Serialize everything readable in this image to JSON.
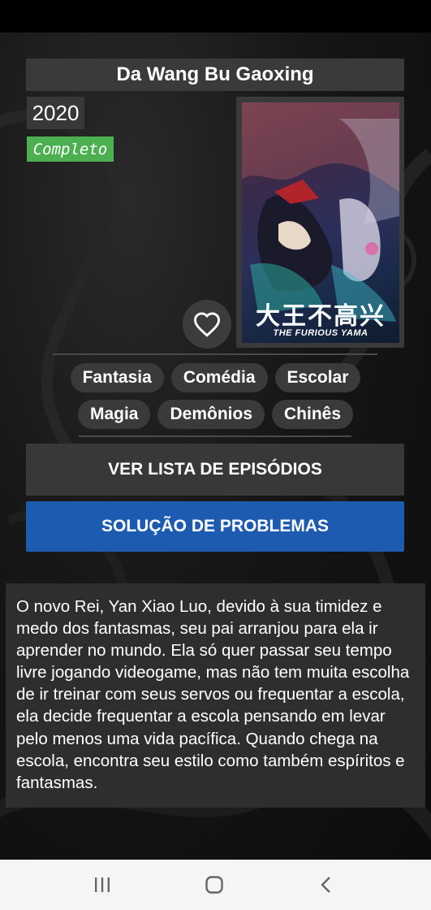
{
  "anime": {
    "title": "Da Wang Bu Gaoxing",
    "year": "2020",
    "status": "Completo",
    "poster": {
      "title_cjk": "大王不高兴",
      "title_en": "THE FURIOUS YAMA"
    }
  },
  "tags": [
    "Fantasia",
    "Comédia",
    "Escolar",
    "Magia",
    "Demônios",
    "Chinês"
  ],
  "buttons": {
    "episodes": "VER LISTA DE EPISÓDIOS",
    "troubleshooting": "SOLUÇÃO DE PROBLEMAS"
  },
  "synopsis": "O novo Rei, Yan Xiao Luo, devido à sua timidez e medo dos fantasmas, seu pai arranjou para ela ir aprender no mundo. Ela só quer passar seu tempo livre jogando videogame, mas não tem muita escolha de ir treinar com seus servos ou frequentar a escola, ela decide frequentar a escola pensando em levar pelo menos uma vida pacífica. Quando chega na escola, encontra seu estilo como também espíritos e fantasmas.",
  "icons": {
    "favorite": "heart-outline-icon",
    "nav_recents": "recents-icon",
    "nav_home": "home-icon",
    "nav_back": "back-icon"
  },
  "colors": {
    "status_badge": "#4caf50",
    "primary_button": "#1d5bb0"
  }
}
